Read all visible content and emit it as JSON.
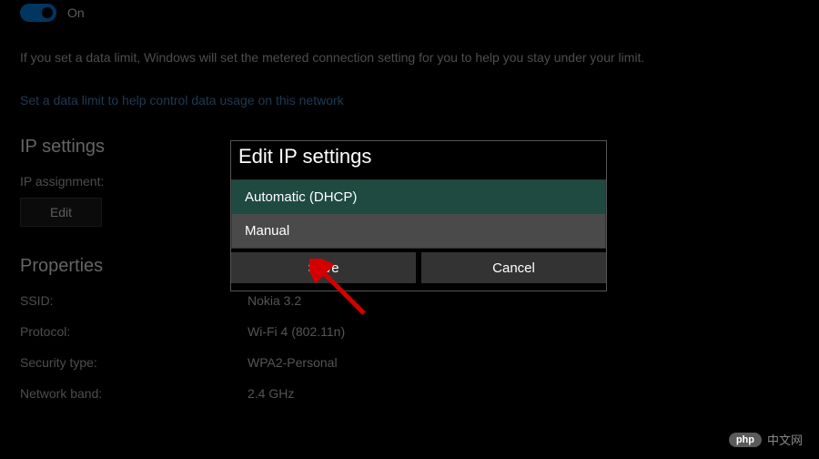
{
  "metered": {
    "toggle_state": "On",
    "description": "If you set a data limit, Windows will set the metered connection setting for you to help you stay under your limit.",
    "link_text": "Set a data limit to help control data usage on this network"
  },
  "ip_settings": {
    "heading": "IP settings",
    "assignment_label": "IP assignment:",
    "edit_button": "Edit"
  },
  "properties": {
    "heading": "Properties",
    "rows": [
      {
        "label": "SSID:",
        "value": "Nokia 3.2"
      },
      {
        "label": "Protocol:",
        "value": "Wi-Fi 4 (802.11n)"
      },
      {
        "label": "Security type:",
        "value": "WPA2-Personal"
      },
      {
        "label": "Network band:",
        "value": "2.4 GHz"
      }
    ]
  },
  "dialog": {
    "title": "Edit IP settings",
    "options": [
      "Automatic (DHCP)",
      "Manual"
    ],
    "save": "Save",
    "cancel": "Cancel"
  },
  "watermark": {
    "badge": "php",
    "text": "中文网"
  }
}
